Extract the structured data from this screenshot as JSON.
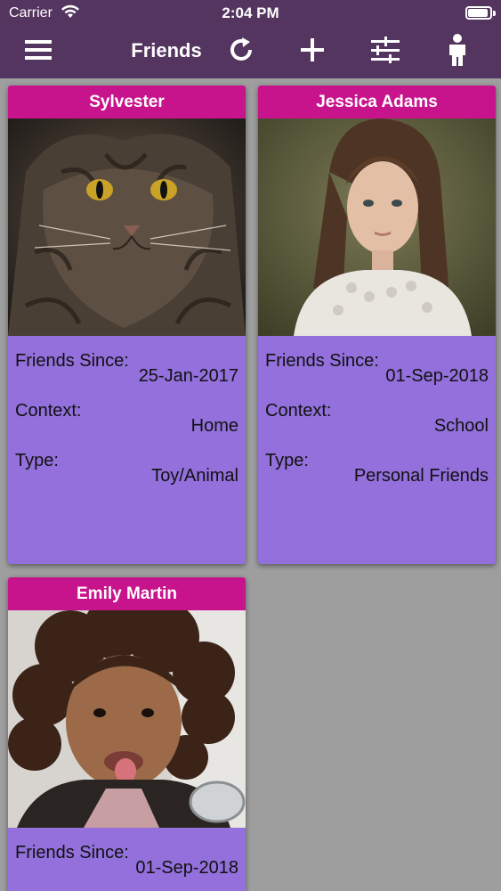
{
  "status_bar": {
    "carrier": "Carrier",
    "time": "2:04 PM"
  },
  "navbar": {
    "title": "Friends",
    "icons": [
      "menu-icon",
      "refresh-icon",
      "add-icon",
      "filter-sliders-icon",
      "person-icon"
    ]
  },
  "colors": {
    "navbar_bg": "#54355f",
    "card_header_bg": "#c8148c",
    "card_body_bg": "#9370db",
    "page_bg": "#9e9e9e"
  },
  "labels": {
    "friends_since": "Friends Since:",
    "context": "Context:",
    "type": "Type:"
  },
  "friends": [
    {
      "name": "Sylvester",
      "friends_since": "25-Jan-2017",
      "context": "Home",
      "type": "Toy/Animal"
    },
    {
      "name": "Jessica Adams",
      "friends_since": "01-Sep-2018",
      "context": "School",
      "type": "Personal Friends"
    },
    {
      "name": "Emily Martin",
      "friends_since": "01-Sep-2018",
      "context": "",
      "type": ""
    }
  ]
}
